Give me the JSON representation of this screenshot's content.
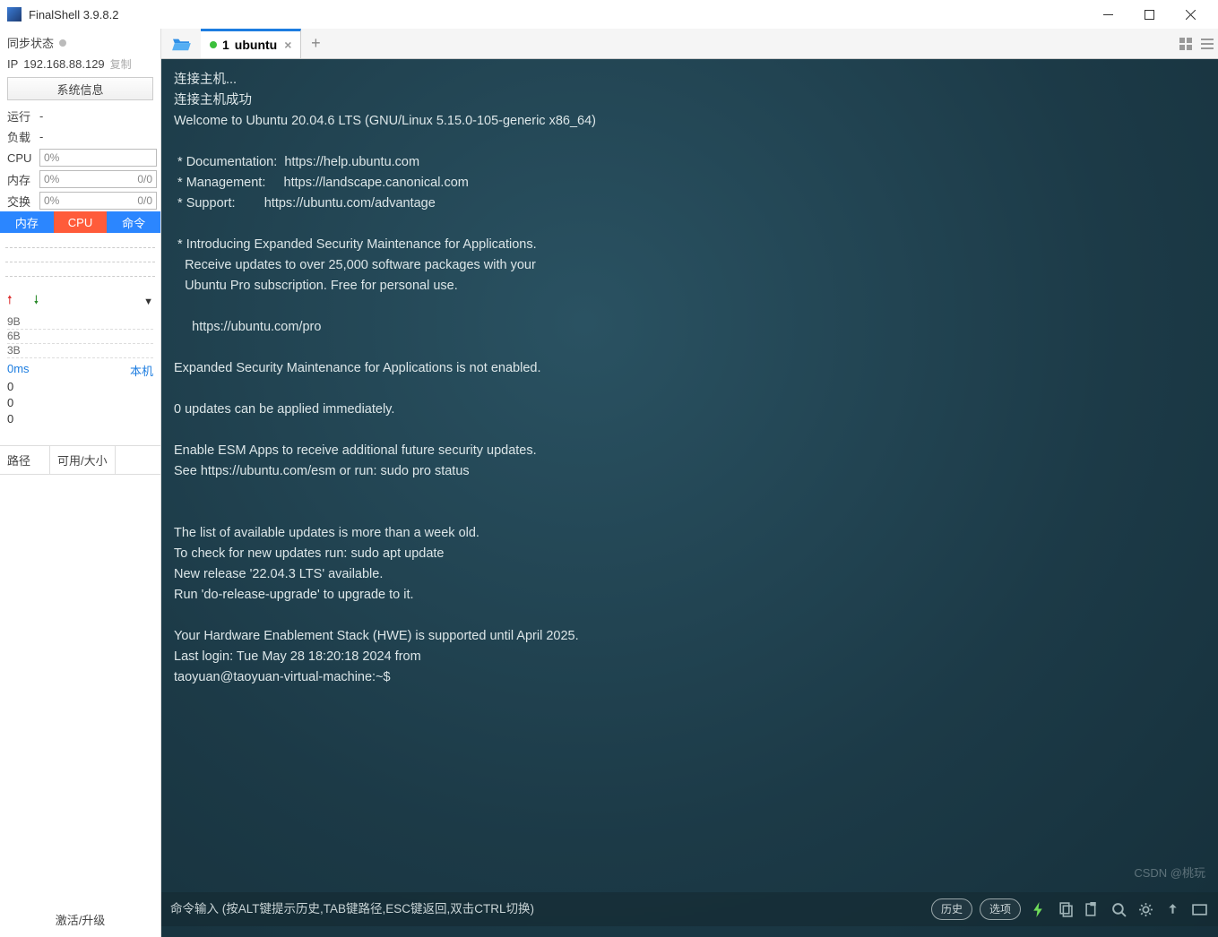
{
  "window": {
    "title": "FinalShell 3.9.8.2"
  },
  "sidebar": {
    "sync_label": "同步状态",
    "ip_label": "IP",
    "ip_value": "192.168.88.129",
    "copy_label": "复制",
    "sys_info_btn": "系统信息",
    "run_label": "运行",
    "run_value": "-",
    "load_label": "负载",
    "load_value": "-",
    "cpu_label": "CPU",
    "cpu_value": "0%",
    "mem_label": "内存",
    "mem_value": "0%",
    "mem_ratio": "0/0",
    "swap_label": "交换",
    "swap_value": "0%",
    "swap_ratio": "0/0",
    "tab_mem": "内存",
    "tab_cpu": "CPU",
    "tab_cmd": "命令",
    "scale": [
      "9B",
      "6B",
      "3B"
    ],
    "ms": "0ms",
    "local": "本机",
    "zeros": [
      "0",
      "0",
      "0"
    ],
    "col_path": "路径",
    "col_size": "可用/大小",
    "activate": "激活/升级"
  },
  "tabs": {
    "active": {
      "index": "1",
      "name": "ubuntu"
    }
  },
  "terminal": {
    "lines": [
      "连接主机...",
      "连接主机成功",
      "Welcome to Ubuntu 20.04.6 LTS (GNU/Linux 5.15.0-105-generic x86_64)",
      "",
      " * Documentation:  https://help.ubuntu.com",
      " * Management:     https://landscape.canonical.com",
      " * Support:        https://ubuntu.com/advantage",
      "",
      " * Introducing Expanded Security Maintenance for Applications.",
      "   Receive updates to over 25,000 software packages with your",
      "   Ubuntu Pro subscription. Free for personal use.",
      "",
      "     https://ubuntu.com/pro",
      "",
      "Expanded Security Maintenance for Applications is not enabled.",
      "",
      "0 updates can be applied immediately.",
      "",
      "Enable ESM Apps to receive additional future security updates.",
      "See https://ubuntu.com/esm or run: sudo pro status",
      "",
      "",
      "The list of available updates is more than a week old.",
      "To check for new updates run: sudo apt update",
      "New release '22.04.3 LTS' available.",
      "Run 'do-release-upgrade' to upgrade to it.",
      "",
      "Your Hardware Enablement Stack (HWE) is supported until April 2025.",
      "Last login: Tue May 28 18:20:18 2024 from ",
      "taoyuan@taoyuan-virtual-machine:~$ "
    ]
  },
  "cmdbar": {
    "hint": "命令输入 (按ALT键提示历史,TAB键路径,ESC键返回,双击CTRL切换)",
    "history": "历史",
    "options": "选项"
  },
  "watermark": "CSDN @桃玩"
}
